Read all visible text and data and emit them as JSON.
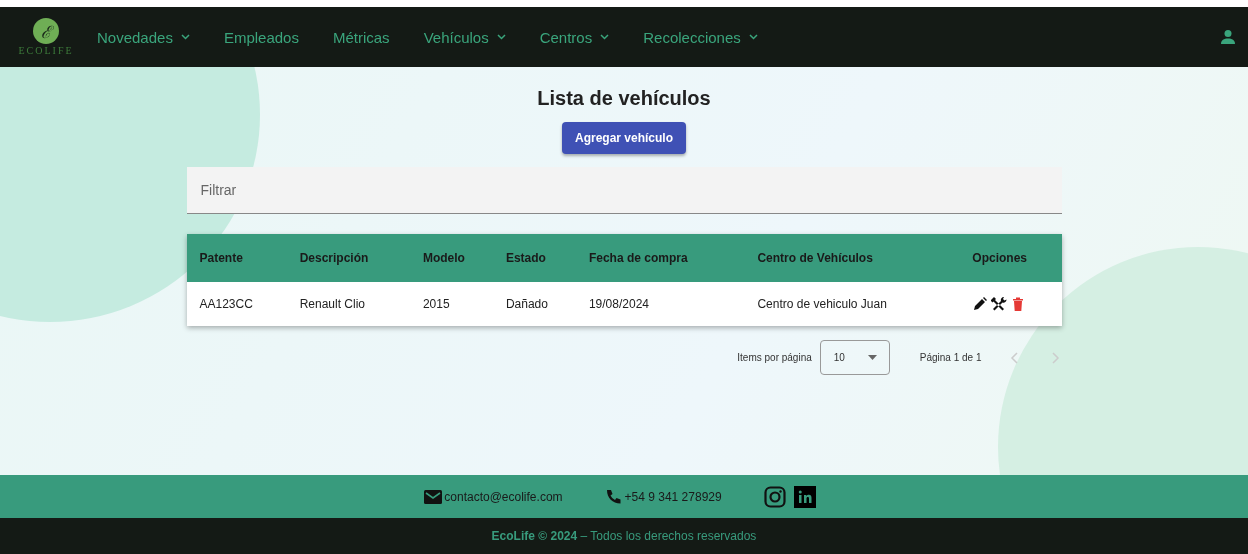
{
  "navbar": {
    "logo": {
      "mark": "ℰ",
      "text": "ECOLIFE"
    },
    "items": [
      {
        "label": "Novedades",
        "has_menu": true
      },
      {
        "label": "Empleados",
        "has_menu": false
      },
      {
        "label": "Métricas",
        "has_menu": false
      },
      {
        "label": "Vehículos",
        "has_menu": true
      },
      {
        "label": "Centros",
        "has_menu": true
      },
      {
        "label": "Recolecciones",
        "has_menu": true
      }
    ]
  },
  "page": {
    "title": "Lista de vehículos",
    "add_button": "Agregar vehículo",
    "filter": {
      "placeholder": "Filtrar"
    }
  },
  "table": {
    "columns": [
      "Patente",
      "Descripción",
      "Modelo",
      "Estado",
      "Fecha de compra",
      "Centro de Vehículos",
      "Opciones"
    ],
    "rows": [
      {
        "cells": [
          "AA123CC",
          "Renault Clio",
          "2015",
          "Dañado",
          "19/08/2024",
          "Centro de vehiculo Juan"
        ]
      }
    ]
  },
  "paginator": {
    "label": "Items por página",
    "page_size": "10",
    "range": "Página 1 de 1"
  },
  "footer": {
    "email": "contacto@ecolife.com",
    "phone": "+54 9 341 278929",
    "copyright": "**EcoLife © 2024** – Todos los derechos reservados"
  }
}
